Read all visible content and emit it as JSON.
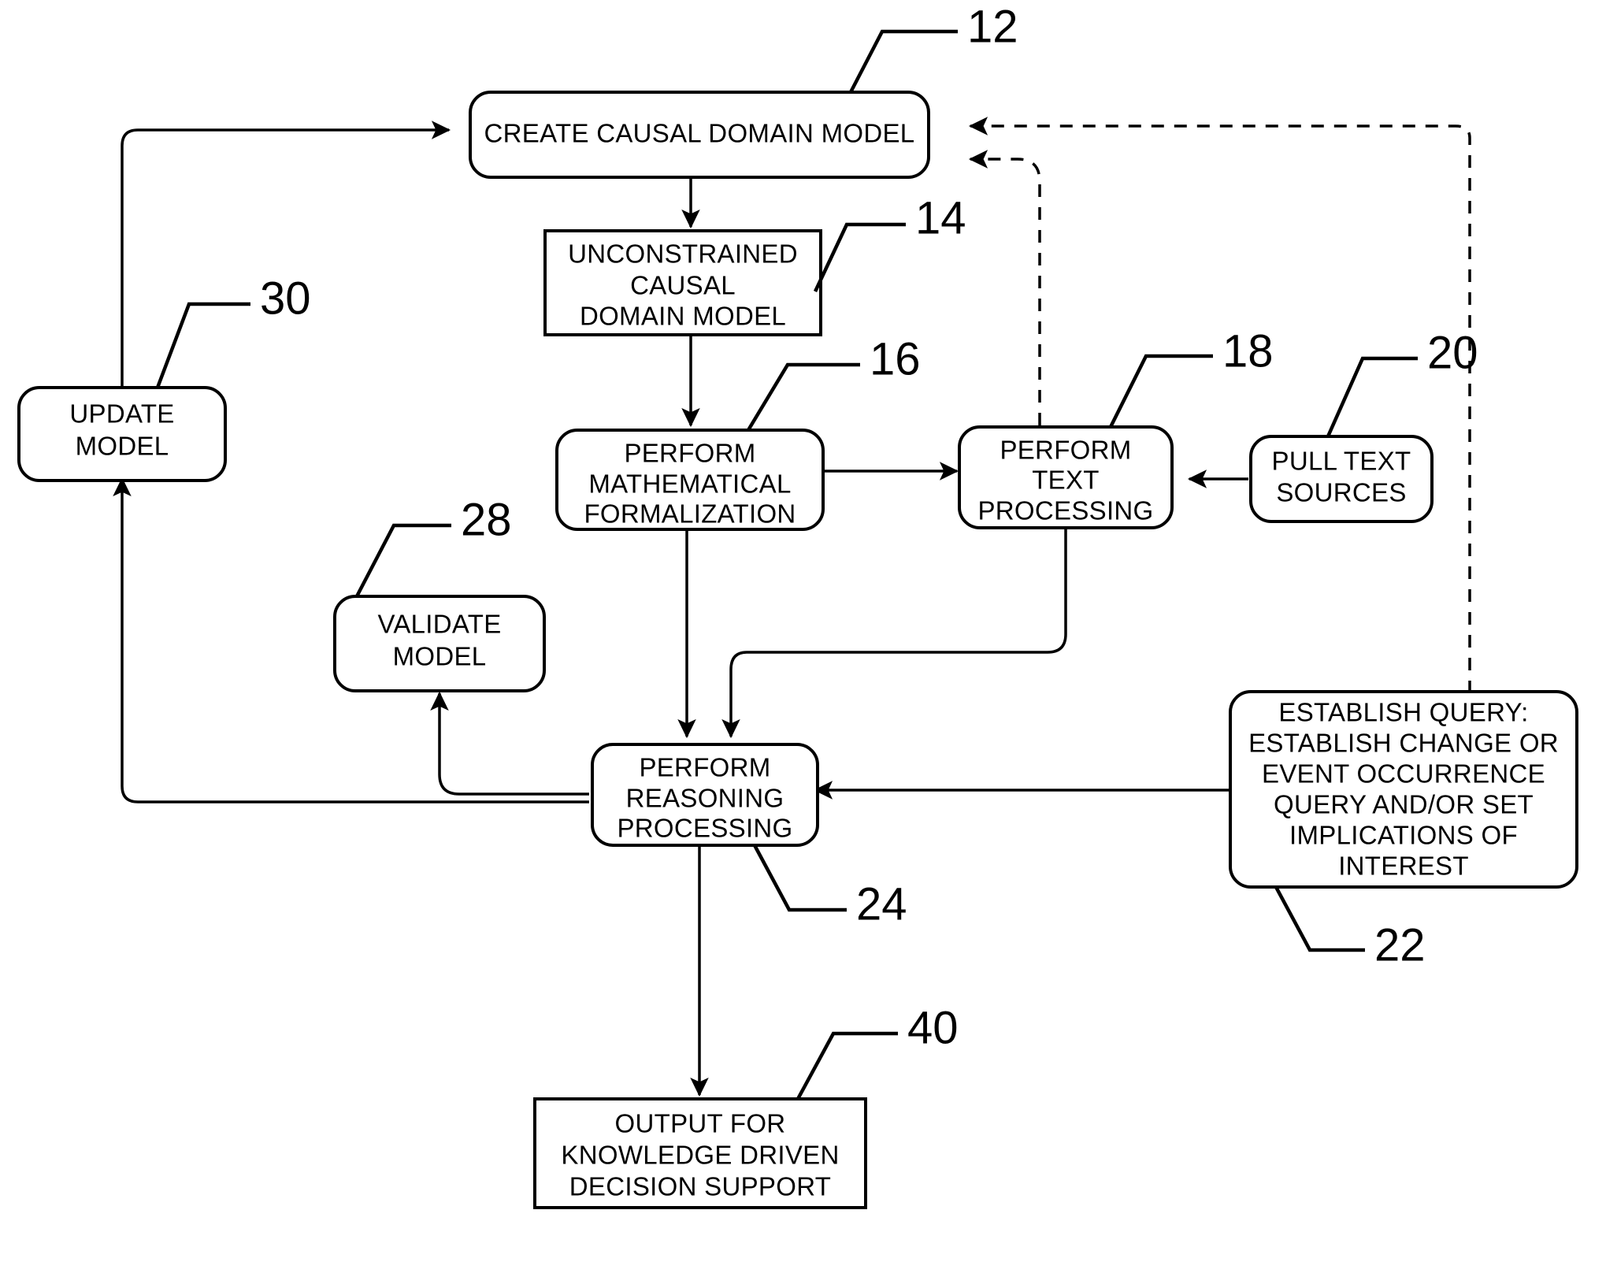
{
  "figure": {
    "type": "patent-flowchart",
    "background_color": "#ffffff",
    "line_color": "#000000"
  },
  "nodes": [
    {
      "id": "create_causal_domain_model",
      "ref": "12",
      "shape": "rounded",
      "lines": [
        "CREATE CAUSAL DOMAIN MODEL"
      ]
    },
    {
      "id": "unconstrained_causal_domain_model",
      "ref": "14",
      "shape": "rect",
      "lines": [
        "UNCONSTRAINED",
        "CAUSAL",
        "DOMAIN MODEL"
      ]
    },
    {
      "id": "perform_mathematical_formalization",
      "ref": "16",
      "shape": "rounded",
      "lines": [
        "PERFORM",
        "MATHEMATICAL",
        "FORMALIZATION"
      ]
    },
    {
      "id": "perform_text_processing",
      "ref": "18",
      "shape": "rounded",
      "lines": [
        "PERFORM",
        "TEXT",
        "PROCESSING"
      ]
    },
    {
      "id": "pull_text_sources",
      "ref": "20",
      "shape": "rounded",
      "lines": [
        "PULL TEXT",
        "SOURCES"
      ]
    },
    {
      "id": "establish_query",
      "ref": "22",
      "shape": "rounded",
      "lines": [
        "ESTABLISH QUERY:",
        "ESTABLISH CHANGE OR",
        "EVENT OCCURRENCE",
        "QUERY AND/OR SET",
        "IMPLICATIONS OF",
        "INTEREST"
      ]
    },
    {
      "id": "perform_reasoning_processing",
      "ref": "24",
      "shape": "rounded",
      "lines": [
        "PERFORM",
        "REASONING",
        "PROCESSING"
      ]
    },
    {
      "id": "validate_model",
      "ref": "28",
      "shape": "rounded",
      "lines": [
        "VALIDATE",
        "MODEL"
      ]
    },
    {
      "id": "update_model",
      "ref": "30",
      "shape": "rounded",
      "lines": [
        "UPDATE",
        "MODEL"
      ]
    },
    {
      "id": "output_decision_support",
      "ref": "40",
      "shape": "rect",
      "lines": [
        "OUTPUT FOR",
        "KNOWLEDGE DRIVEN",
        "DECISION SUPPORT"
      ]
    }
  ],
  "reference_numerals": [
    {
      "id": "ref-12",
      "value": "12"
    },
    {
      "id": "ref-14",
      "value": "14"
    },
    {
      "id": "ref-16",
      "value": "16"
    },
    {
      "id": "ref-18",
      "value": "18"
    },
    {
      "id": "ref-20",
      "value": "20"
    },
    {
      "id": "ref-22",
      "value": "22"
    },
    {
      "id": "ref-24",
      "value": "24"
    },
    {
      "id": "ref-28",
      "value": "28"
    },
    {
      "id": "ref-30",
      "value": "30"
    },
    {
      "id": "ref-40",
      "value": "40"
    }
  ],
  "node_text": {
    "create_causal_domain_model_l1": "CREATE CAUSAL DOMAIN MODEL",
    "unconstrained_l1": "UNCONSTRAINED",
    "unconstrained_l2": "CAUSAL",
    "unconstrained_l3": "DOMAIN MODEL",
    "math_l1": "PERFORM",
    "math_l2": "MATHEMATICAL",
    "math_l3": "FORMALIZATION",
    "text_l1": "PERFORM",
    "text_l2": "TEXT",
    "text_l3": "PROCESSING",
    "pull_l1": "PULL TEXT",
    "pull_l2": "SOURCES",
    "query_l1": "ESTABLISH QUERY:",
    "query_l2": "ESTABLISH CHANGE OR",
    "query_l3": "EVENT OCCURRENCE",
    "query_l4": "QUERY AND/OR SET",
    "query_l5": "IMPLICATIONS OF",
    "query_l6": "INTEREST",
    "reason_l1": "PERFORM",
    "reason_l2": "REASONING",
    "reason_l3": "PROCESSING",
    "validate_l1": "VALIDATE",
    "validate_l2": "MODEL",
    "update_l1": "UPDATE",
    "update_l2": "MODEL",
    "output_l1": "OUTPUT FOR",
    "output_l2": "KNOWLEDGE DRIVEN",
    "output_l3": "DECISION SUPPORT"
  },
  "connections": [
    {
      "id": "update-to-create",
      "from": "update_model",
      "to": "create_causal_domain_model",
      "style": "solid",
      "arrow": true
    },
    {
      "id": "create-to-unconstrained",
      "from": "create_causal_domain_model",
      "to": "unconstrained_causal_domain_model",
      "style": "solid",
      "arrow": true
    },
    {
      "id": "unconstrained-to-math",
      "from": "unconstrained_causal_domain_model",
      "to": "perform_mathematical_formalization",
      "style": "solid",
      "arrow": true
    },
    {
      "id": "math-to-text",
      "from": "perform_mathematical_formalization",
      "to": "perform_text_processing",
      "style": "solid",
      "arrow": true
    },
    {
      "id": "pull-to-text",
      "from": "pull_text_sources",
      "to": "perform_text_processing",
      "style": "solid",
      "arrow": true
    },
    {
      "id": "math-to-reasoning",
      "from": "perform_mathematical_formalization",
      "to": "perform_reasoning_processing",
      "style": "solid",
      "arrow": true
    },
    {
      "id": "text-to-reasoning",
      "from": "perform_text_processing",
      "to": "perform_reasoning_processing",
      "style": "solid",
      "arrow": true
    },
    {
      "id": "query-to-reasoning",
      "from": "establish_query",
      "to": "perform_reasoning_processing",
      "style": "solid",
      "arrow": true
    },
    {
      "id": "reasoning-to-validate",
      "from": "perform_reasoning_processing",
      "to": "validate_model",
      "style": "solid",
      "arrow": true
    },
    {
      "id": "reasoning-to-update",
      "from": "perform_reasoning_processing",
      "to": "update_model",
      "style": "solid",
      "arrow": true
    },
    {
      "id": "reasoning-to-output",
      "from": "perform_reasoning_processing",
      "to": "output_decision_support",
      "style": "solid",
      "arrow": true
    },
    {
      "id": "query-to-create-dashed",
      "from": "establish_query",
      "to": "create_causal_domain_model",
      "style": "dashed",
      "arrow": true
    },
    {
      "id": "text-to-create-dashed",
      "from": "perform_text_processing",
      "to": "create_causal_domain_model",
      "style": "dashed",
      "arrow": true
    }
  ]
}
